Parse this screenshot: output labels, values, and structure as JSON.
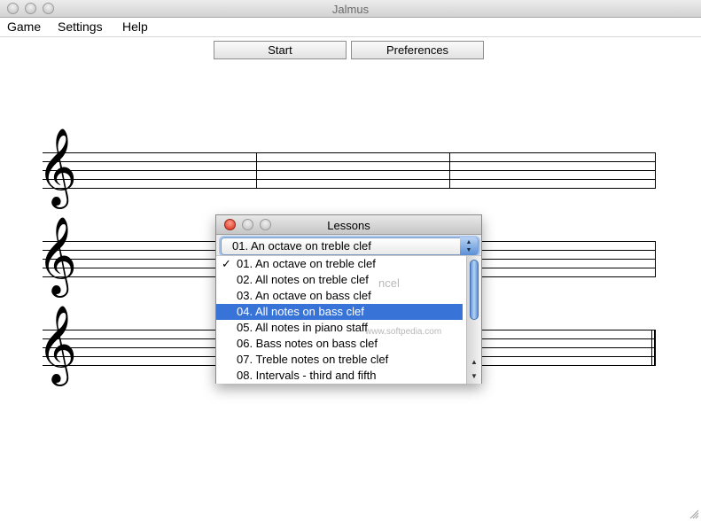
{
  "window": {
    "title": "Jalmus"
  },
  "menu": {
    "items": [
      "Game",
      "Settings",
      "Help"
    ]
  },
  "toolbar": {
    "start_label": "Start",
    "preferences_label": "Preferences"
  },
  "staves": {
    "clef_glyph": "𝄞",
    "clef_icon": "treble-clef-icon"
  },
  "dialog": {
    "title": "Lessons",
    "selected_value": "01. An octave on treble clef",
    "items": [
      {
        "label": "01. An octave on treble clef",
        "check": "✓"
      },
      {
        "label": "02. All notes on treble clef",
        "check": ""
      },
      {
        "label": "03. An octave on bass clef",
        "check": ""
      },
      {
        "label": "04. All notes on bass clef",
        "check": ""
      },
      {
        "label": "05. All notes in piano staff",
        "check": ""
      },
      {
        "label": "06. Bass notes on bass clef",
        "check": ""
      },
      {
        "label": "07. Treble notes on treble clef",
        "check": ""
      },
      {
        "label": "08. Intervals - third and fifth",
        "check": ""
      }
    ],
    "highlighted_index": 3,
    "ghost_cancel": "ncel",
    "watermark": "SOFTPEDIA",
    "watermark_url": "www.softpedia.com"
  },
  "colors": {
    "selection": "#3874d8",
    "close_button": "#d42a16",
    "focus_ring": "#a9c6ef"
  }
}
